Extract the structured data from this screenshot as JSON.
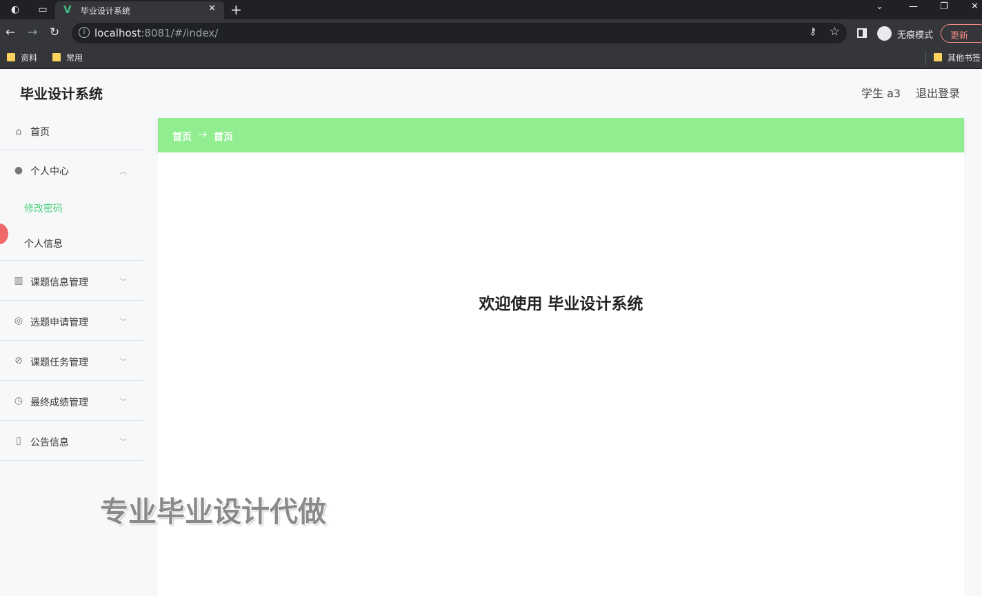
{
  "browser": {
    "tab_title": "毕业设计系统",
    "tab_close": "✕",
    "new_tab": "+",
    "url_host": "localhost",
    "url_rest": ":8081/#/index/",
    "incognito_label": "无痕模式",
    "update_label": "更新",
    "bookmarks": [
      "资料",
      "常用"
    ],
    "other_bookmarks": "其他书签"
  },
  "app": {
    "title": "毕业设计系统",
    "user": "学生 a3",
    "logout": "退出登录"
  },
  "sidebar": {
    "home": "首页",
    "personal_center": "个人中心",
    "sub_items": [
      "修改密码",
      "个人信息"
    ],
    "items": [
      "课题信息管理",
      "选题申请管理",
      "课题任务管理",
      "最终成绩管理",
      "公告信息"
    ]
  },
  "breadcrumb": {
    "first": "首页",
    "arrow": "→",
    "second": "首页"
  },
  "main": {
    "welcome": "欢迎使用 毕业设计系统"
  },
  "overlay": {
    "watermark": "专业毕业设计代做"
  }
}
